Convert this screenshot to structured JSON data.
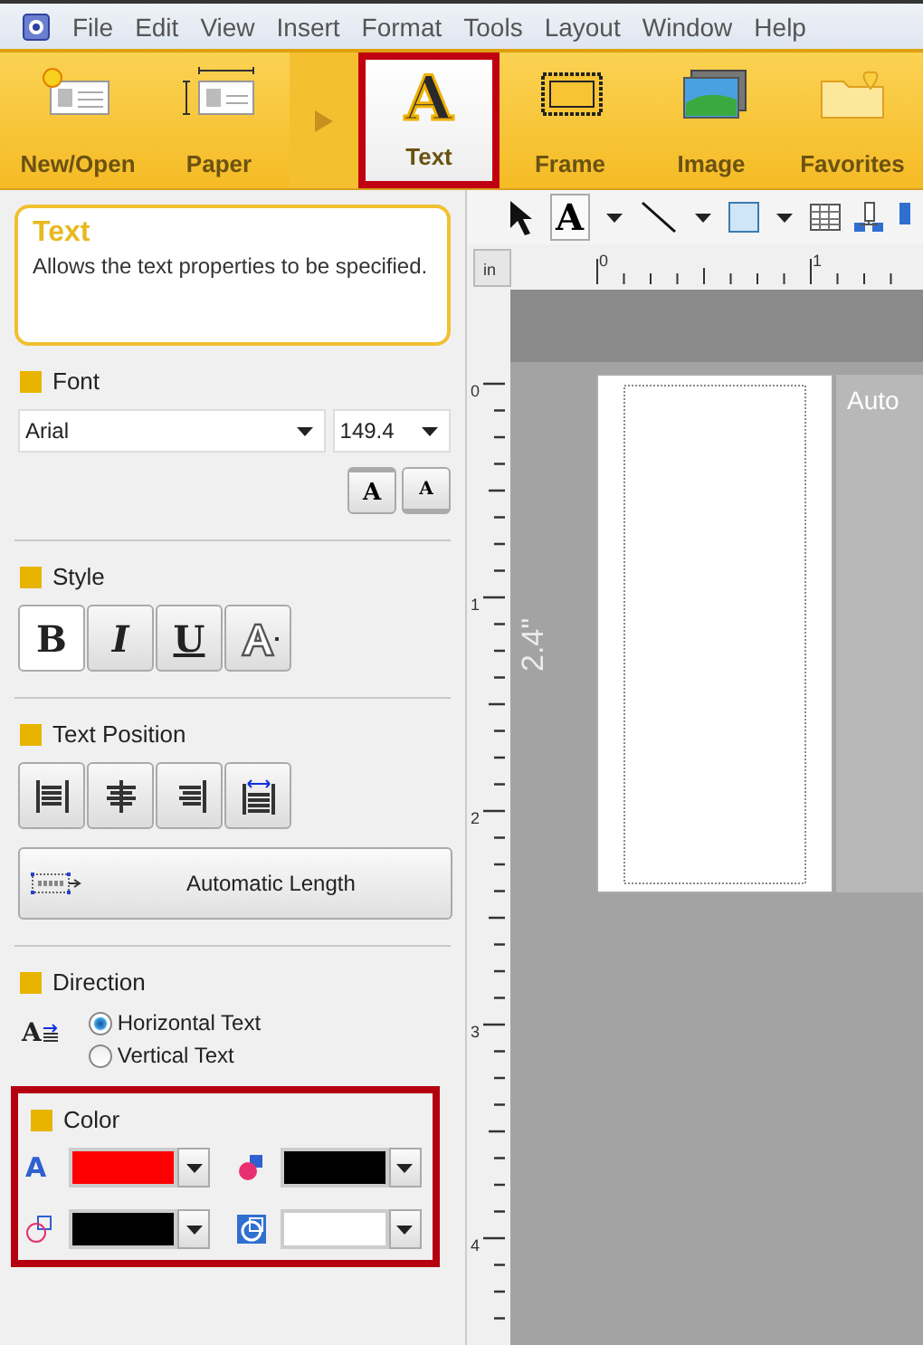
{
  "menu": [
    "File",
    "Edit",
    "View",
    "Insert",
    "Format",
    "Tools",
    "Layout",
    "Window",
    "Help"
  ],
  "ribbon": [
    {
      "kind": "new",
      "label": "New/Open",
      "selected": false,
      "highlight": false
    },
    {
      "kind": "paper",
      "label": "Paper",
      "selected": false,
      "highlight": false
    },
    {
      "kind": "separator"
    },
    {
      "kind": "text",
      "label": "Text",
      "glyph": "A",
      "selected": true,
      "highlight": true
    },
    {
      "kind": "frame",
      "label": "Frame",
      "selected": false,
      "highlight": false
    },
    {
      "kind": "image",
      "label": "Image",
      "selected": false,
      "highlight": false
    },
    {
      "kind": "favorites",
      "label": "Favorites",
      "selected": false,
      "highlight": false
    }
  ],
  "info": {
    "title": "Text",
    "description": "Allows the text properties to be specified."
  },
  "font": {
    "title": "Font",
    "family": "Arial",
    "size": "149.4",
    "size_buttons": [
      {
        "kind": "grow",
        "label": "A"
      },
      {
        "kind": "shrink",
        "label": "A"
      }
    ]
  },
  "style": {
    "title": "Style",
    "buttons": [
      {
        "kind": "bold",
        "label": "B",
        "selected": true
      },
      {
        "kind": "italic",
        "label": "I",
        "selected": false
      },
      {
        "kind": "underline",
        "label": "U",
        "selected": false
      },
      {
        "kind": "outline",
        "selected": false
      }
    ]
  },
  "position": {
    "title": "Text Position",
    "buttons": [
      {
        "kind": "left"
      },
      {
        "kind": "center"
      },
      {
        "kind": "right"
      },
      {
        "kind": "justify"
      }
    ],
    "auto_length": "Automatic Length"
  },
  "direction": {
    "title": "Direction",
    "glyph": "A",
    "options": [
      {
        "label": "Horizontal Text",
        "selected": true
      },
      {
        "label": "Vertical Text",
        "selected": false
      }
    ]
  },
  "color": {
    "title": "Color",
    "highlight": true,
    "pickers": [
      {
        "kind": "text",
        "glyph": "A",
        "color": "#ff0000"
      },
      {
        "kind": "fill",
        "color": "#000000"
      },
      {
        "kind": "frame",
        "color": "#000000"
      },
      {
        "kind": "background",
        "color": "#ffffff"
      }
    ]
  },
  "toolbar": {
    "glyph": "A"
  },
  "workspace": {
    "unit": "in",
    "h_labels": [
      "0",
      "1"
    ],
    "v_labels": [
      "0",
      "1",
      "2",
      "3",
      "4"
    ],
    "length": "2.4\"",
    "side_text": "Auto"
  }
}
